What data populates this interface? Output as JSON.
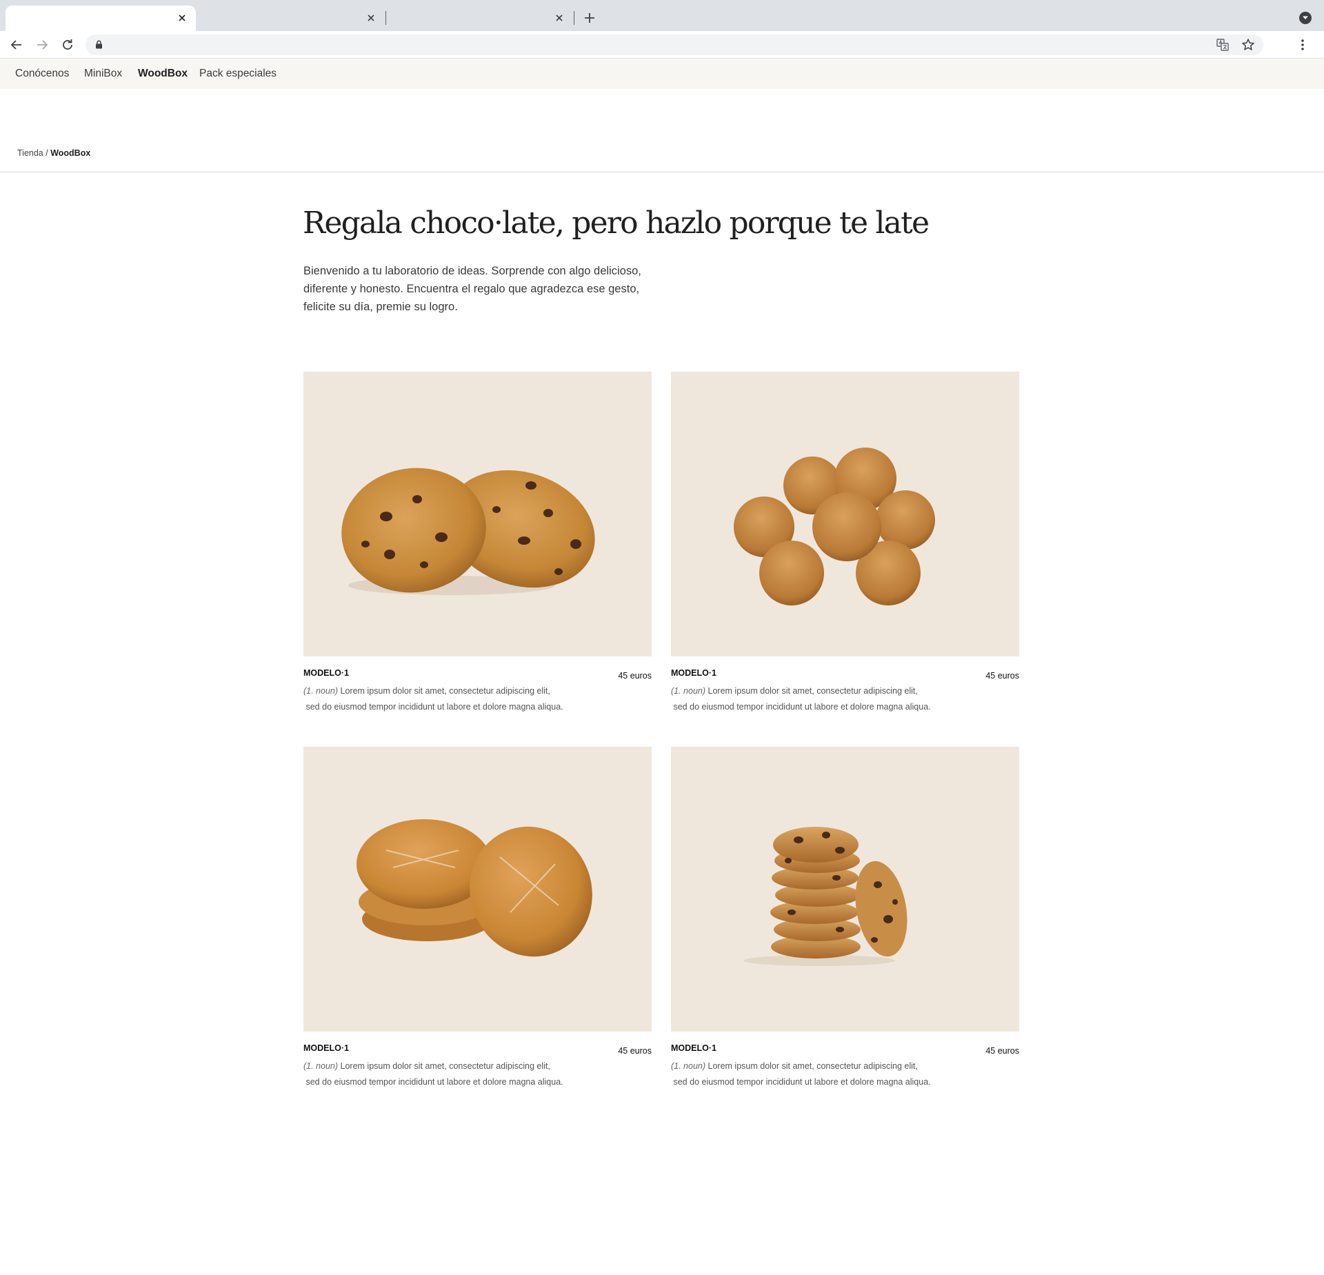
{
  "browser": {
    "tabs": [
      {
        "title": "",
        "active": true
      },
      {
        "title": "",
        "active": false
      },
      {
        "title": "",
        "active": false
      }
    ],
    "address_value": ""
  },
  "site_nav": {
    "items": [
      {
        "label": "Conócenos",
        "current": false
      },
      {
        "label": "MiniBox",
        "current": false
      },
      {
        "label": "WoodBox",
        "current": true
      },
      {
        "label": "Pack especiales",
        "current": false
      }
    ]
  },
  "breadcrumb": {
    "parent": "Tienda",
    "separator": " / ",
    "current": "WoodBox"
  },
  "hero": {
    "title": "Regala choco·late, pero hazlo porque te late",
    "text": "Bienvenido a tu laboratorio de ideas. Sorprende con algo delicioso, diferente y honesto. Encuentra el regalo que agradezca ese gesto, felicite su día, premie su logro."
  },
  "products": [
    {
      "name": "MODELO·1",
      "price": "45 euros",
      "note": "(1. noun)",
      "desc_line1": "Lorem ipsum dolor sit amet, consectetur adipiscing elit,",
      "desc_line2": "sed do eiusmod tempor incididunt ut labore et dolore magna aliqua.",
      "image": "chocolate-chip-cookies-pair"
    },
    {
      "name": "MODELO·1",
      "price": "45 euros",
      "note": "(1. noun)",
      "desc_line1": "Lorem ipsum dolor sit amet, consectetur adipiscing elit,",
      "desc_line2": "sed do eiusmod tempor incididunt ut labore et dolore magna aliqua.",
      "image": "round-biscuit-pile"
    },
    {
      "name": "MODELO·1",
      "price": "45 euros",
      "note": "(1. noun)",
      "desc_line1": "Lorem ipsum dolor sit amet, consectetur adipiscing elit,",
      "desc_line2": "sed do eiusmod tempor incididunt ut labore et dolore magna aliqua.",
      "image": "sugar-cookies-stack"
    },
    {
      "name": "MODELO·1",
      "price": "45 euros",
      "note": "(1. noun)",
      "desc_line1": "Lorem ipsum dolor sit amet, consectetur adipiscing elit,",
      "desc_line2": "sed do eiusmod tempor incididunt ut labore et dolore magna aliqua.",
      "image": "chocolate-chip-cookie-tower"
    }
  ],
  "colors": {
    "tabstrip": "#dee1e6",
    "nav_background": "#f7f6f2",
    "photo_background": "#f0e7dc",
    "cookie_golden": "#c98a3e",
    "chocolate_chip": "#4a2a18"
  }
}
